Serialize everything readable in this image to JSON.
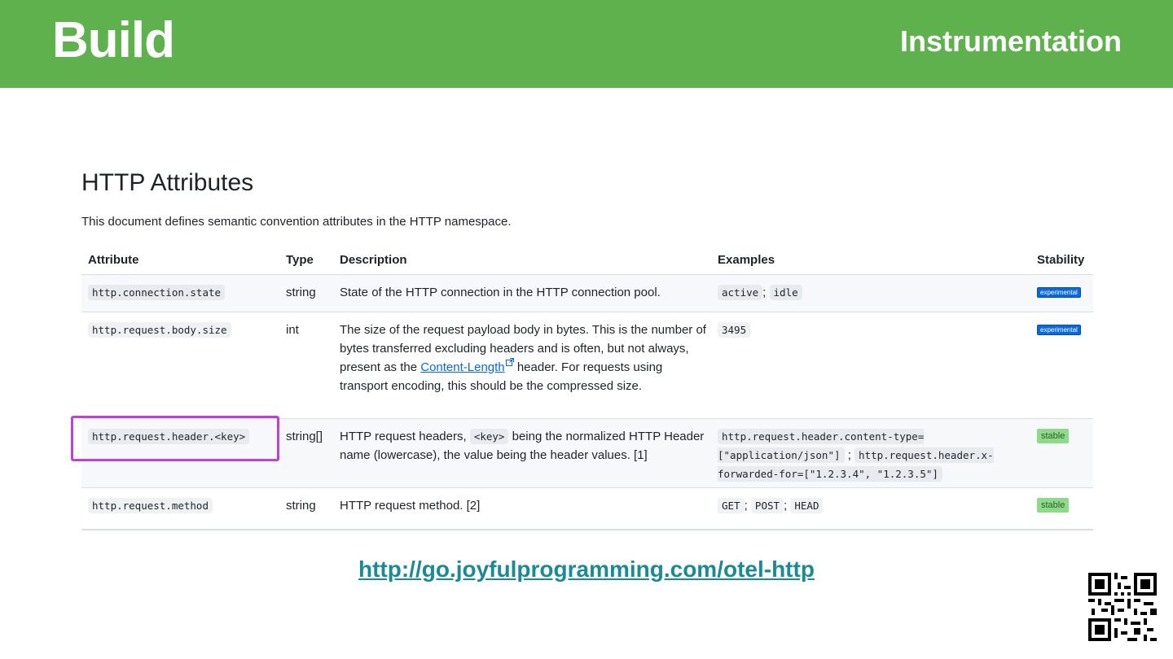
{
  "banner": {
    "title": "Build",
    "section": "Instrumentation",
    "color": "#5eb14d"
  },
  "doc": {
    "title": "HTTP Attributes",
    "intro": "This document defines semantic convention attributes in the HTTP namespace."
  },
  "table": {
    "headers": {
      "attribute": "Attribute",
      "type": "Type",
      "description": "Description",
      "examples": "Examples",
      "stability": "Stability"
    },
    "rows": [
      {
        "attribute": "http.connection.state",
        "type": "string",
        "description": "State of the HTTP connection in the HTTP connection pool.",
        "examples": [
          "active",
          "idle"
        ],
        "stability": "experimental"
      },
      {
        "attribute": "http.request.body.size",
        "type": "int",
        "description_before": "The size of the request payload body in bytes. This is the number of bytes transferred excluding headers and is often, but not always, present as the",
        "description_link": "Content-Length",
        "description_after": "header. For requests using transport encoding, this should be the compressed size.",
        "examples": [
          "3495"
        ],
        "stability": "experimental"
      },
      {
        "attribute": "http.request.header.<key>",
        "type": "string[]",
        "description_before": "HTTP request headers,",
        "description_code": "<key>",
        "description_after": "being the normalized HTTP Header name (lowercase), the value being the header values. [1]",
        "examples": [
          "http.request.header.content-type=[\"application/json\"]",
          "http.request.header.x-forwarded-for=[\"1.2.3.4\", \"1.2.3.5\"]"
        ],
        "stability": "stable",
        "highlighted": true
      },
      {
        "attribute": "http.request.method",
        "type": "string",
        "description": "HTTP request method. [2]",
        "examples": [
          "GET",
          "POST",
          "HEAD"
        ],
        "stability": "stable"
      }
    ],
    "separator": ";"
  },
  "footer": {
    "link": "http://go.joyfulprogramming.com/otel-http",
    "link_color": "#1b8a93"
  },
  "colors": {
    "highlight": "#c13fd8",
    "experimental_badge": "#0969da",
    "stable_badge": "#8fd98a"
  }
}
